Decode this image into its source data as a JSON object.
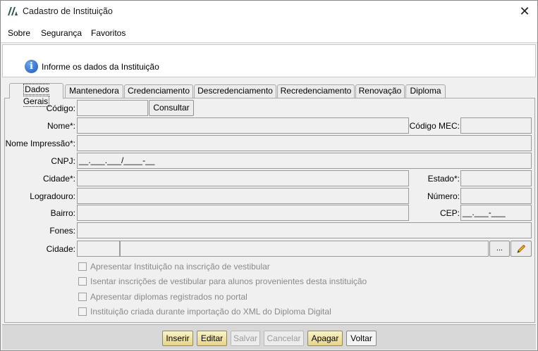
{
  "window": {
    "title": "Cadastro de Instituição",
    "close_glyph": "✕"
  },
  "menu": {
    "items": [
      "Sobre",
      "Segurança",
      "Favoritos"
    ]
  },
  "info": {
    "icon": "info-icon",
    "glyph": "i",
    "text": "Informe os dados da Instituição"
  },
  "tabs": [
    "Dados Gerais",
    "Mantenedora",
    "Credenciamento",
    "Descredenciamento",
    "Recredenciamento",
    "Renovação",
    "Diploma"
  ],
  "form": {
    "codigo_label": "Código:",
    "consultar_label": "Consultar",
    "nome_label": "Nome*:",
    "codigo_mec_label": "Código MEC:",
    "nome_impressao_label": "Nome Impressão*:",
    "cnpj_label": "CNPJ:",
    "cnpj_mask": "__.___.___/____-__",
    "cidade_label": "Cidade*:",
    "estado_label": "Estado*:",
    "logradouro_label": "Logradouro:",
    "numero_label": "Número:",
    "bairro_label": "Bairro:",
    "cep_label": "CEP:",
    "cep_mask": "__.___-___",
    "fones_label": "Fones:",
    "cidade2_label": "Cidade:",
    "lookup_glyph": "...",
    "edit_icon": "pencil-icon"
  },
  "checkboxes": [
    "Apresentar Instituição na inscrição de vestibular",
    "Isentar inscrições de vestibular para alunos provenientes desta instituição",
    "Apresentar diplomas registrados no portal",
    "Instituição criada durante importação do XML do Diploma Digital"
  ],
  "footer": {
    "inserir": "Inserir",
    "editar": "Editar",
    "salvar": "Salvar",
    "cancelar": "Cancelar",
    "apagar": "Apagar",
    "voltar": "Voltar"
  },
  "colors": {
    "active_button_top": "#fbf3c8",
    "active_button_bottom": "#e7d58a",
    "info_blue": "#1d56b8"
  }
}
